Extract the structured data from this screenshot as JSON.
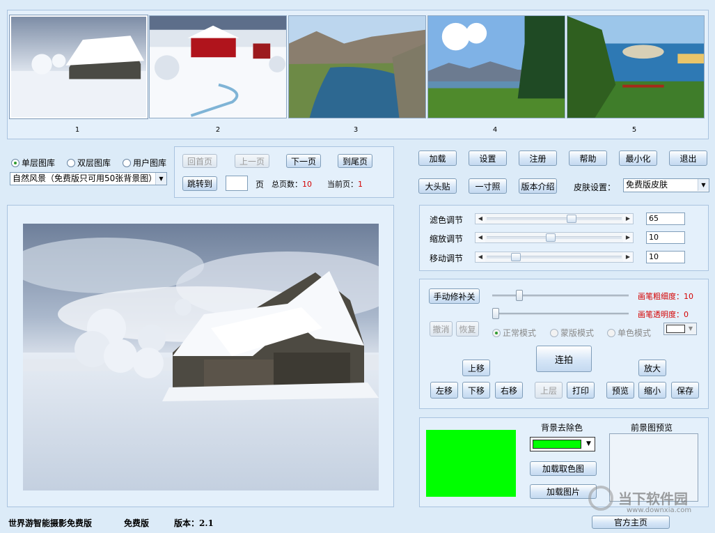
{
  "thumbnails": [
    {
      "num": "1",
      "scene": "snow-hut"
    },
    {
      "num": "2",
      "scene": "red-barn-snow"
    },
    {
      "num": "3",
      "scene": "canyon-river"
    },
    {
      "num": "4",
      "scene": "mountain-lake"
    },
    {
      "num": "5",
      "scene": "tropical-coast"
    }
  ],
  "library": {
    "radio_single": "单层图库",
    "radio_double": "双层图库",
    "radio_user": "用户图库",
    "selected": "single",
    "category_value": "自然风景（免费版只可用50张背景图）"
  },
  "pager": {
    "first": "回首页",
    "prev": "上一页",
    "next": "下一页",
    "last": "到尾页",
    "jump": "跳转到",
    "page_input": "",
    "page_unit": "页",
    "total_label": "总页数：",
    "total_value": "10",
    "current_label": "当前页：",
    "current_value": "1"
  },
  "toolbar": {
    "load": "加载",
    "settings": "设置",
    "register": "注册",
    "help": "帮助",
    "minimize": "最小化",
    "exit": "退出",
    "big_head": "大头贴",
    "one_inch": "一寸照",
    "version_intro": "版本介绍",
    "skin_label": "皮肤设置：",
    "skin_value": "免费版皮肤"
  },
  "adjust": {
    "filter_label": "滤色调节",
    "filter_value": "65",
    "filter_level": 0.65,
    "zoom_label": "缩放调节",
    "zoom_value": "10",
    "zoom_level": 0.45,
    "move_label": "移动调节",
    "move_value": "10",
    "move_level": 0.2
  },
  "edit": {
    "manual_fix": "手动修补关",
    "brush_width_label": "画笔粗细度：",
    "brush_width_value": "10",
    "brush_opacity_label": "画笔透明度：",
    "brush_opacity_value": "0",
    "undo": "撤消",
    "redo": "恢复",
    "mode_normal": "正常模式",
    "mode_mask": "蒙版模式",
    "mode_mono": "单色模式",
    "burst": "连拍",
    "up": "上移",
    "enlarge": "放大",
    "left": "左移",
    "down": "下移",
    "right": "右移",
    "layer_up": "上层",
    "print": "打印",
    "preview": "预览",
    "shrink": "缩小",
    "save": "保存"
  },
  "bgremove": {
    "title": "背景去除色",
    "color": "#00ff00",
    "load_color": "加载取色图",
    "load_image": "加载图片",
    "fg_preview": "前景图预览"
  },
  "footer": {
    "app_name": "世界游智能摄影免费版",
    "edition": "免费版",
    "version": "版本：2.1",
    "home": "官方主页"
  },
  "watermark": {
    "brand": "当下软件园",
    "url": "www.downxia.com"
  }
}
